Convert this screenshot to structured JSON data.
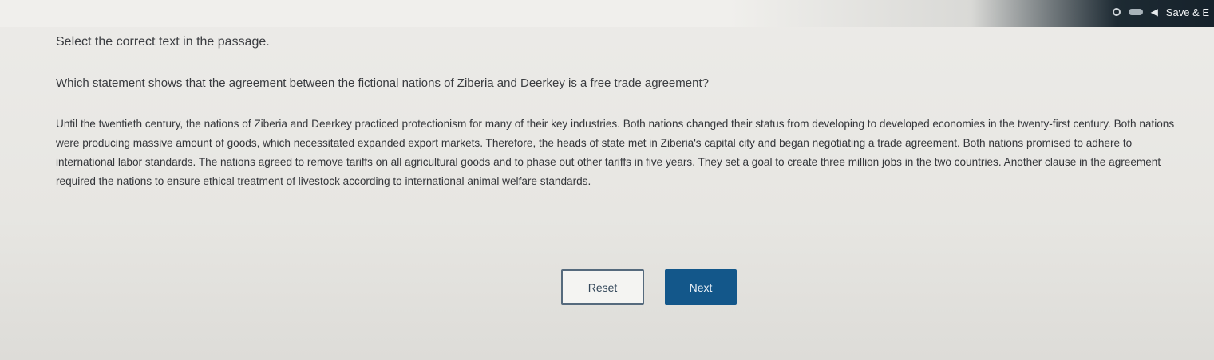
{
  "header": {
    "save_exit_label": "Save & E",
    "icons": [
      "status-ring-icon",
      "battery-icon",
      "save-icon"
    ]
  },
  "instruction": "Select the correct text in the passage.",
  "question": "Which statement shows that the agreement between the fictional nations of Ziberia and Deerkey is a free trade agreement?",
  "passage": {
    "sentences": [
      "Until the twentieth century, the nations of Ziberia and Deerkey practiced protectionism for many of their key industries.",
      "Both nations changed their status from developing to developed economies in the twenty-first century.",
      "Both nations were producing massive amount of goods, which necessitated expanded export markets.",
      "Therefore, the heads of state met in Ziberia's capital city and began negotiating a trade agreement.",
      "Both nations promised to adhere to international labor standards.",
      "The nations agreed to remove tariffs on all agricultural goods and to phase out other tariffs in five years.",
      "They set a goal to create three million jobs in the two countries.",
      "Another clause in the agreement required the nations to ensure ethical treatment of livestock according to international animal welfare standards."
    ]
  },
  "buttons": {
    "reset_label": "Reset",
    "next_label": "Next"
  },
  "colors": {
    "next_button": "#13578a",
    "reset_border": "#556a7d",
    "header_dark": "#16222b"
  }
}
